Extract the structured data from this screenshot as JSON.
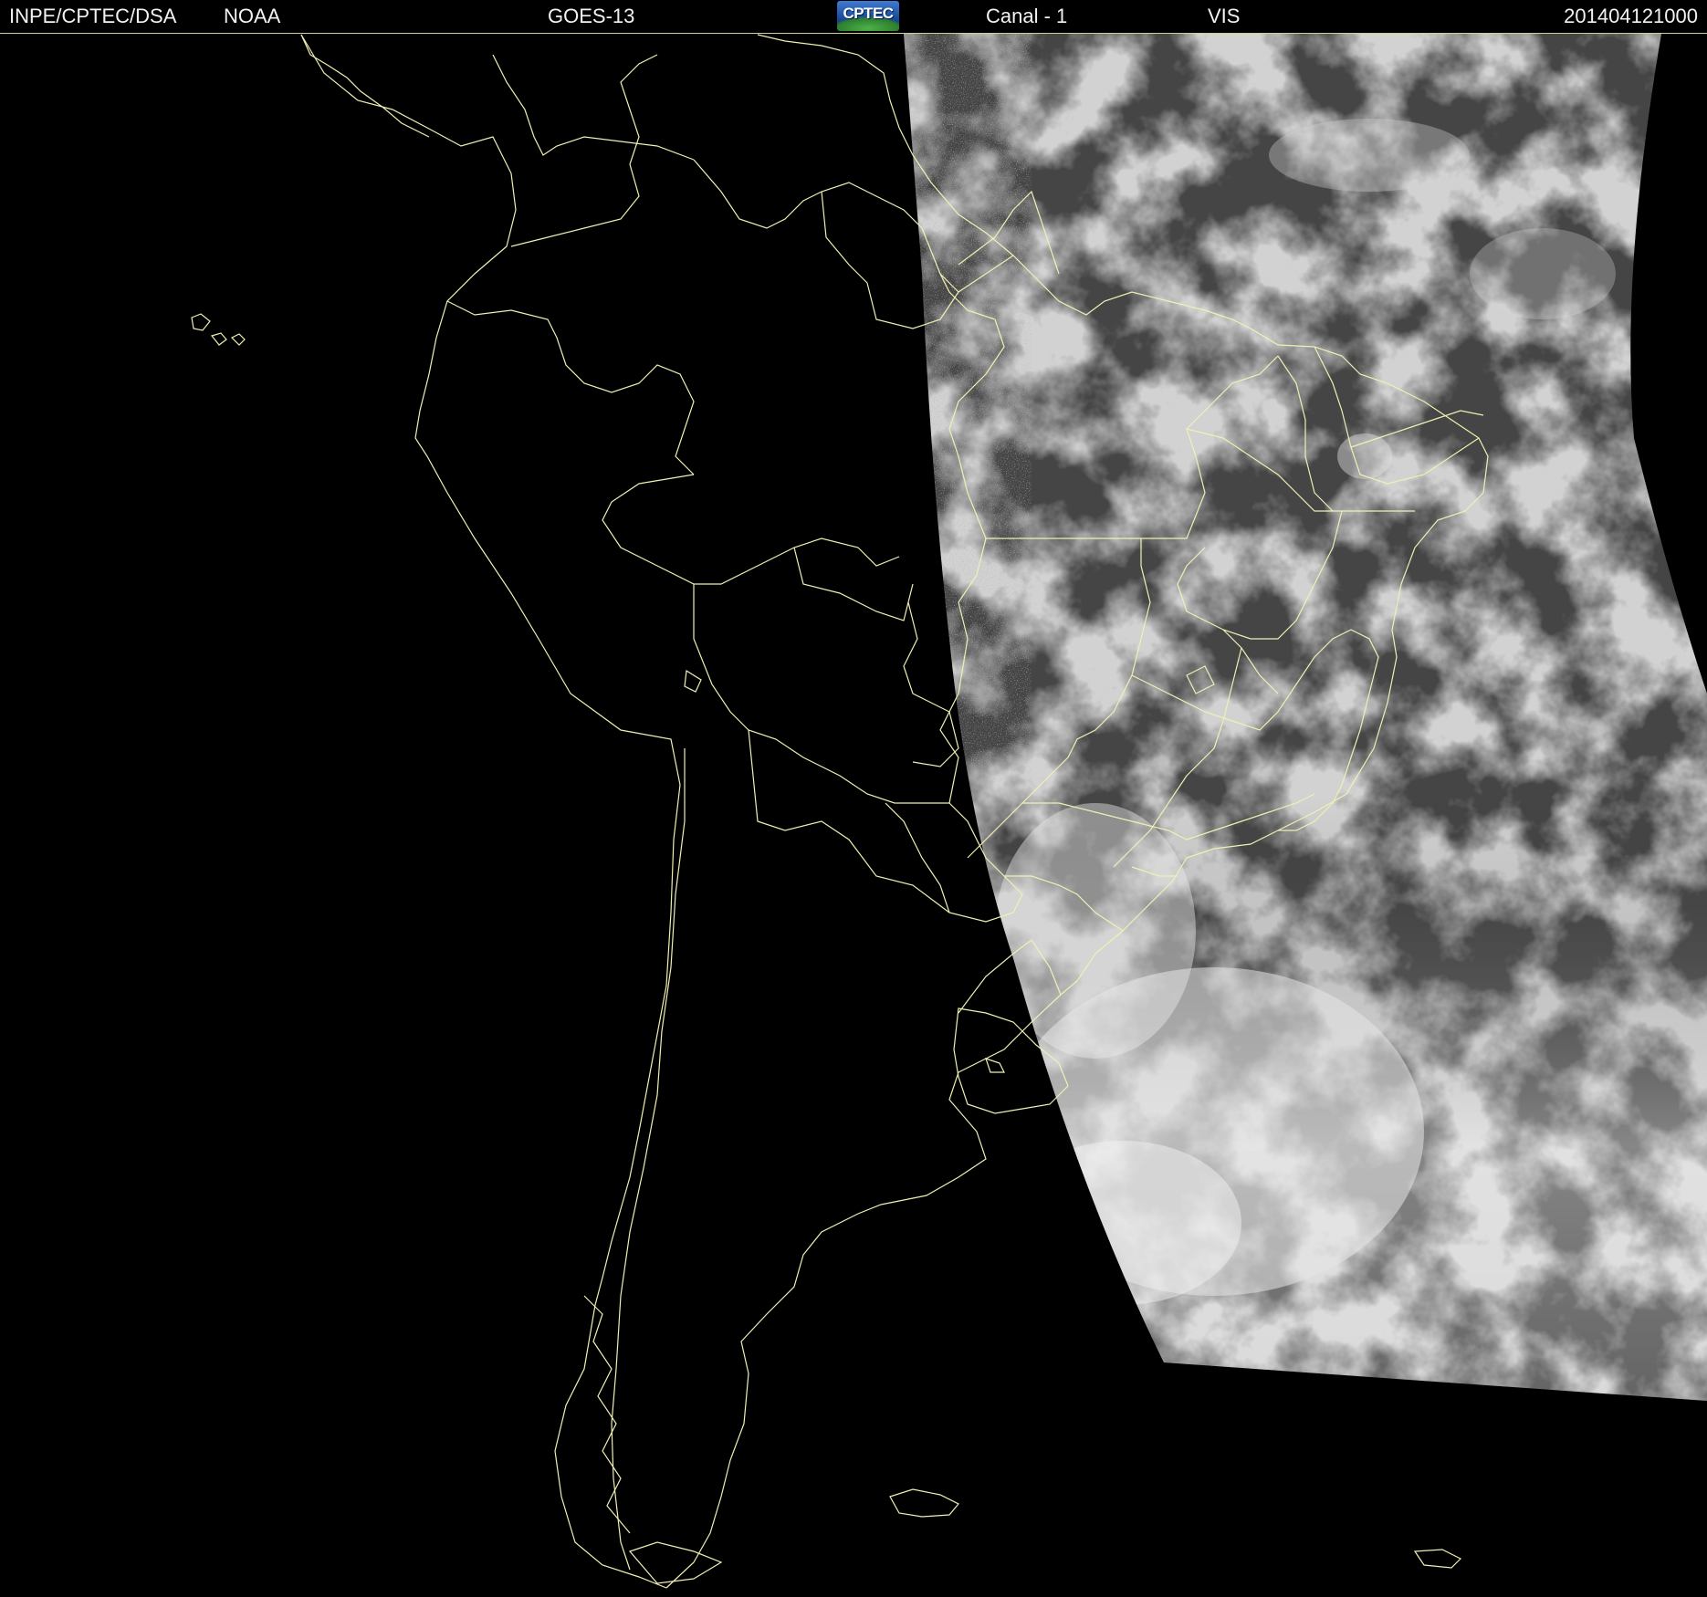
{
  "header": {
    "source": "INPE/CPTEC/DSA",
    "agency": "NOAA",
    "satellite": "GOES-13",
    "logo_text": "CPTEC",
    "channel": "Canal - 1",
    "band": "VIS",
    "timestamp": "201404121000"
  },
  "map": {
    "background_color": "#000000",
    "border_color": "#f0f0b4",
    "cloud_color": "#e8e8e8",
    "land_color": "#4a4a4a"
  }
}
